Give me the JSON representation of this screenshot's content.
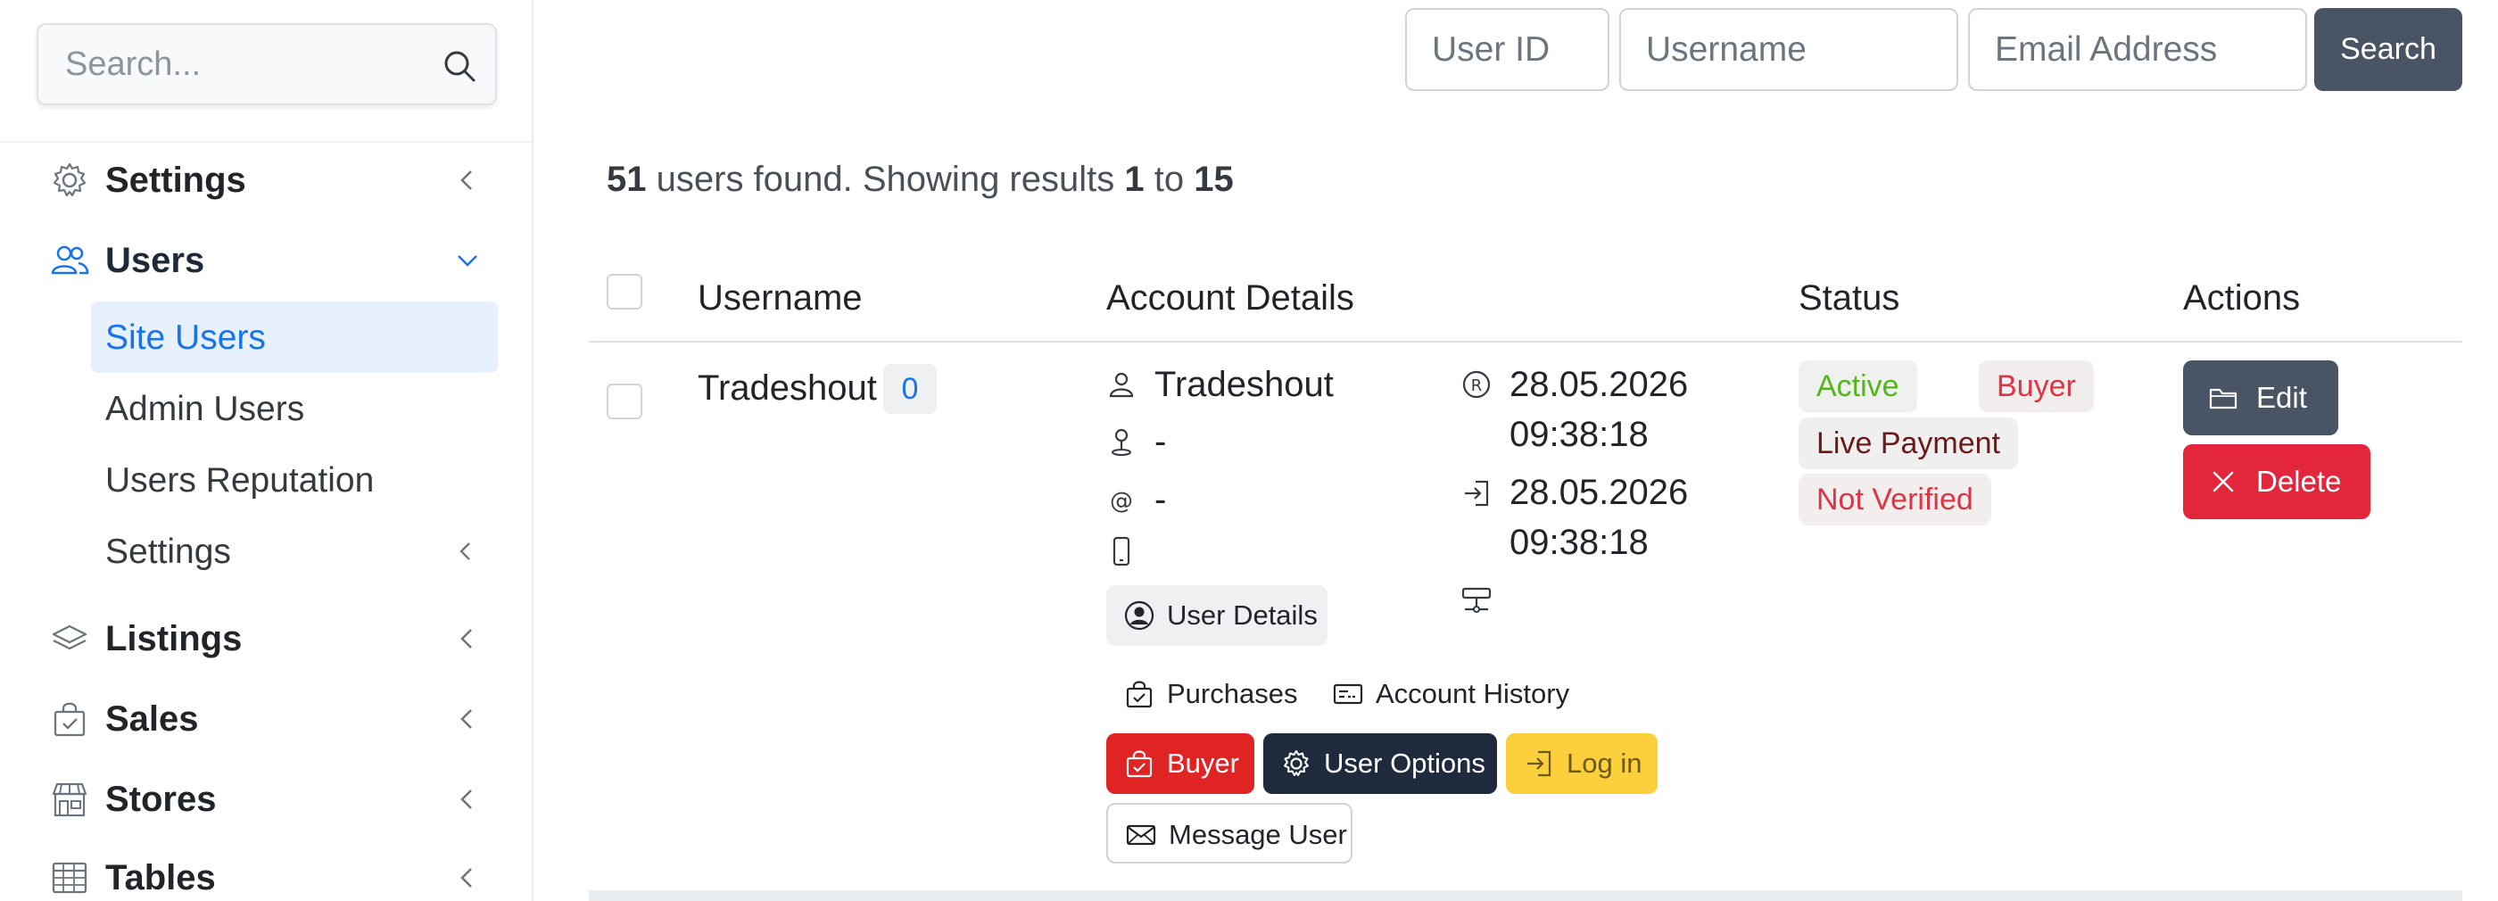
{
  "sidebar": {
    "search_placeholder": "Search...",
    "items": [
      {
        "label": "Settings"
      },
      {
        "label": "Users"
      },
      {
        "label": "Listings"
      },
      {
        "label": "Sales"
      },
      {
        "label": "Stores"
      },
      {
        "label": "Tables"
      }
    ],
    "users_subitems": [
      {
        "label": "Site Users",
        "active": true
      },
      {
        "label": "Admin Users"
      },
      {
        "label": "Users Reputation"
      },
      {
        "label": "Settings"
      }
    ]
  },
  "filters": {
    "user_id_placeholder": "User ID",
    "username_placeholder": "Username",
    "email_placeholder": "Email Address",
    "search_label": "Search"
  },
  "results": {
    "total": "51",
    "text_found": "users found. Showing results",
    "from": "1",
    "to_word": "to",
    "to": "15"
  },
  "table": {
    "headers": {
      "username": "Username",
      "account_details": "Account Details",
      "status": "Status",
      "actions": "Actions"
    },
    "rows": [
      {
        "username": "Tradeshout",
        "count": "0",
        "details": {
          "name": "Tradeshout",
          "location": "-",
          "email": "-",
          "phone": "",
          "registered_date": "28.05.2026",
          "registered_time": "09:38:18",
          "last_login_date": "28.05.2026",
          "last_login_time": "09:38:18"
        },
        "buttons": {
          "user_details": "User Details",
          "purchases": "Purchases",
          "account_history": "Account History",
          "buyer": "Buyer",
          "user_options": "User Options",
          "log_in": "Log in",
          "message_user": "Message User"
        },
        "status": [
          "Active",
          "Buyer",
          "Live Payment",
          "Not Verified"
        ],
        "actions": {
          "edit": "Edit",
          "delete": "Delete"
        }
      }
    ]
  },
  "colors": {
    "accent": "#1a73e8",
    "active_bg": "#e7f1fd",
    "dark_button": "#495464",
    "danger": "#e4263c",
    "buyer_btn": "#e02424",
    "options_btn": "#1f2a3c",
    "login_btn": "#fccf3c",
    "status_active": "#55b51a"
  }
}
